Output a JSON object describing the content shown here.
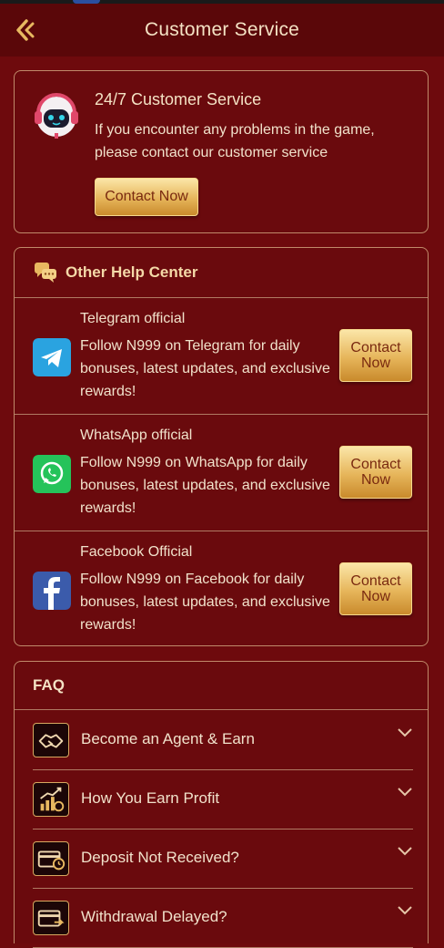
{
  "header": {
    "title": "Customer Service"
  },
  "support": {
    "title": "24/7 Customer Service",
    "description": "If you encounter any problems in the game, please contact our customer service",
    "button": "Contact Now"
  },
  "help_center": {
    "title": "Other Help Center",
    "items": [
      {
        "name": "Telegram official",
        "description": "Follow N999 on Telegram for daily bonuses, latest updates, and exclusive rewards!",
        "button": "Contact Now",
        "icon": "telegram-icon"
      },
      {
        "name": "WhatsApp official",
        "description": "Follow N999 on WhatsApp for daily bonuses, latest updates, and exclusive rewards!",
        "button": "Contact Now",
        "icon": "whatsapp-icon"
      },
      {
        "name": "Facebook Official",
        "description": "Follow N999 on Facebook for daily bonuses, latest updates, and exclusive rewards!",
        "button": "Contact Now",
        "icon": "facebook-icon"
      }
    ]
  },
  "faq": {
    "title": "FAQ",
    "items": [
      {
        "label": "Become an Agent & Earn",
        "icon": "handshake-icon"
      },
      {
        "label": "How You Earn Profit",
        "icon": "growth-chart-icon"
      },
      {
        "label": "Deposit Not Received?",
        "icon": "deposit-card-icon"
      },
      {
        "label": "Withdrawal Delayed?",
        "icon": "withdrawal-card-icon"
      }
    ]
  },
  "colors": {
    "background": "#6e0a0d",
    "header": "#5a0709",
    "border": "#c08a6a",
    "gold": "#e6b55a",
    "telegram": "#2aa3e0",
    "whatsapp": "#25c35a",
    "facebook": "#3b5bab"
  }
}
